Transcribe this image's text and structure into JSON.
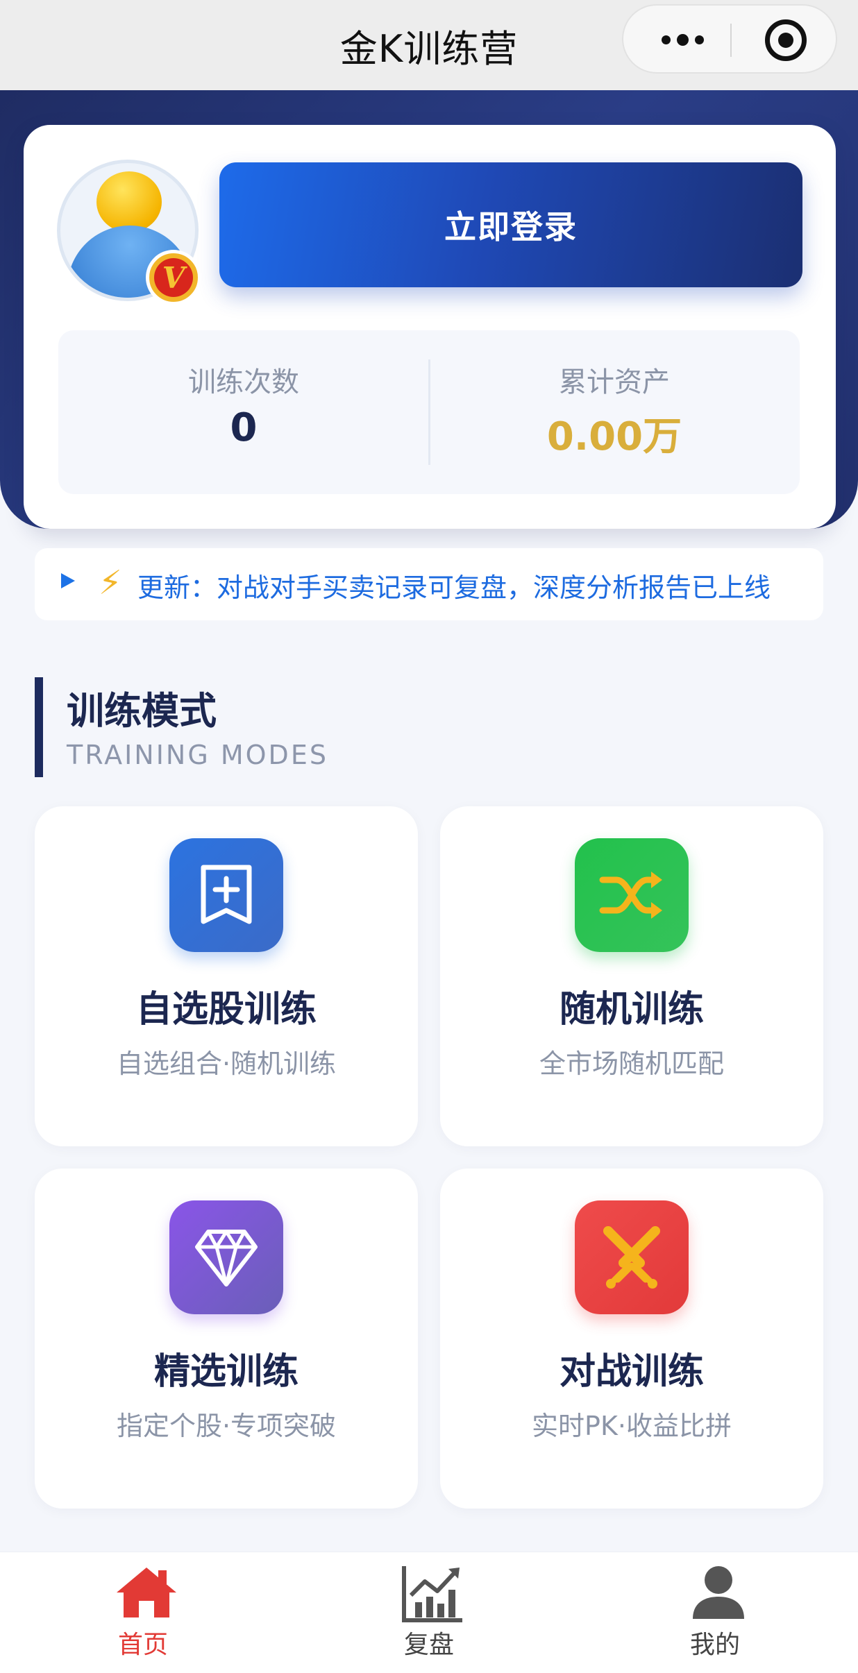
{
  "window": {
    "title": "金K训练营",
    "more_icon": "more-dots-icon",
    "close_icon": "target-icon"
  },
  "profile": {
    "avatar_icon": "user-avatar-icon",
    "badge_letter": "V",
    "login_label": "立即登录",
    "stats": [
      {
        "label": "训练次数",
        "value": "0"
      },
      {
        "label": "累计资产",
        "value": "0.00万"
      }
    ]
  },
  "notice": {
    "icon": "lightning-icon",
    "text": "更新：对战对手买卖记录可复盘，深度分析报告已上线"
  },
  "section": {
    "title": "训练模式",
    "subtitle": "TRAINING MODES"
  },
  "modes": [
    {
      "name": "自选股训练",
      "desc": "自选组合·随机训练",
      "icon": "bookmark-plus-icon",
      "color": "#2c73e0"
    },
    {
      "name": "随机训练",
      "desc": "全市场随机匹配",
      "icon": "shuffle-icon",
      "color": "#22c14c"
    },
    {
      "name": "精选训练",
      "desc": "指定个股·专项突破",
      "icon": "diamond-icon",
      "color": "#8a55e8"
    },
    {
      "name": "对战训练",
      "desc": "实时PK·收益比拼",
      "icon": "crossed-swords-icon",
      "color": "#ef4b4b"
    }
  ],
  "tabbar": {
    "items": [
      {
        "label": "首页",
        "icon": "home-icon",
        "active": true
      },
      {
        "label": "复盘",
        "icon": "chart-icon",
        "active": false
      },
      {
        "label": "我的",
        "icon": "person-icon",
        "active": false
      }
    ],
    "active_color": "#e23a35"
  }
}
